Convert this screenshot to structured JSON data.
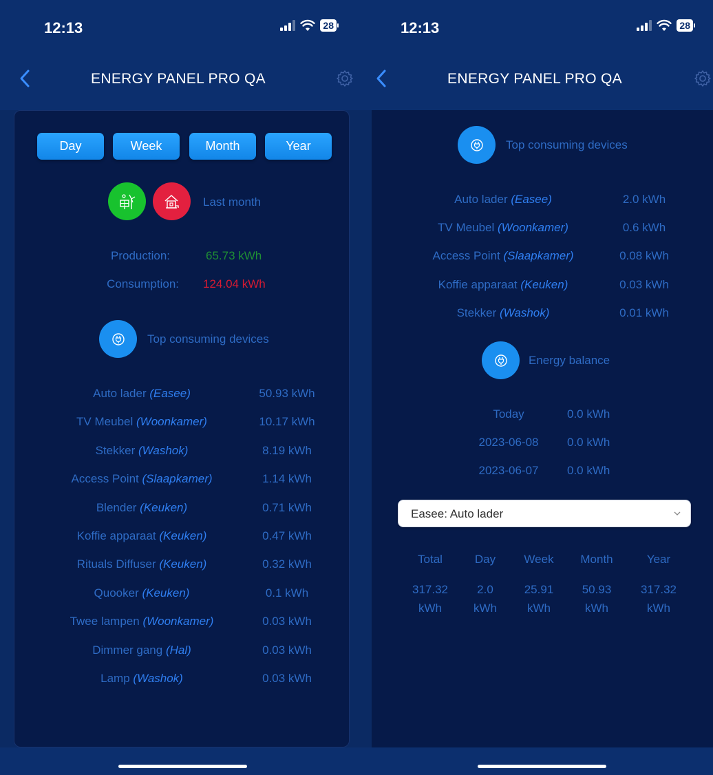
{
  "status": {
    "time": "12:13",
    "battery": "28"
  },
  "nav": {
    "title": "ENERGY PANEL PRO QA"
  },
  "periods": [
    "Day",
    "Week",
    "Month",
    "Year"
  ],
  "summary": {
    "label": "Last month",
    "production_label": "Production:",
    "production_value": "65.73 kWh",
    "consumption_label": "Consumption:",
    "consumption_value": "124.04 kWh"
  },
  "top_devices_title": "Top consuming devices",
  "left_devices": [
    {
      "name": "Auto lader",
      "loc": "(Easee)",
      "value": "50.93 kWh"
    },
    {
      "name": "TV Meubel",
      "loc": "(Woonkamer)",
      "value": "10.17 kWh"
    },
    {
      "name": "Stekker",
      "loc": "(Washok)",
      "value": "8.19 kWh"
    },
    {
      "name": "Access Point",
      "loc": "(Slaapkamer)",
      "value": "1.14 kWh"
    },
    {
      "name": "Blender",
      "loc": "(Keuken)",
      "value": "0.71 kWh"
    },
    {
      "name": "Koffie apparaat",
      "loc": "(Keuken)",
      "value": "0.47 kWh"
    },
    {
      "name": "Rituals Diffuser",
      "loc": "(Keuken)",
      "value": "0.32 kWh"
    },
    {
      "name": "Quooker",
      "loc": "(Keuken)",
      "value": "0.1 kWh"
    },
    {
      "name": "Twee lampen",
      "loc": "(Woonkamer)",
      "value": "0.03 kWh"
    },
    {
      "name": "Dimmer gang",
      "loc": "(Hal)",
      "value": "0.03 kWh"
    },
    {
      "name": "Lamp",
      "loc": "(Washok)",
      "value": "0.03 kWh"
    }
  ],
  "right_devices": [
    {
      "name": "Auto lader",
      "loc": "(Easee)",
      "value": "2.0 kWh"
    },
    {
      "name": "TV Meubel",
      "loc": "(Woonkamer)",
      "value": "0.6 kWh"
    },
    {
      "name": "Access Point",
      "loc": "(Slaapkamer)",
      "value": "0.08 kWh"
    },
    {
      "name": "Koffie apparaat",
      "loc": "(Keuken)",
      "value": "0.03 kWh"
    },
    {
      "name": "Stekker",
      "loc": "(Washok)",
      "value": "0.01 kWh"
    }
  ],
  "energy_balance": {
    "title": "Energy balance",
    "rows": [
      {
        "label": "Today",
        "value": "0.0 kWh"
      },
      {
        "label": "2023-06-08",
        "value": "0.0 kWh"
      },
      {
        "label": "2023-06-07",
        "value": "0.0 kWh"
      }
    ]
  },
  "device_select": {
    "value": "Easee: Auto lader"
  },
  "device_stats": [
    {
      "label": "Total",
      "value": "317.32",
      "unit": "kWh"
    },
    {
      "label": "Day",
      "value": "2.0",
      "unit": "kWh"
    },
    {
      "label": "Week",
      "value": "25.91",
      "unit": "kWh"
    },
    {
      "label": "Month",
      "value": "50.93",
      "unit": "kWh"
    },
    {
      "label": "Year",
      "value": "317.32",
      "unit": "kWh"
    }
  ],
  "colors": {
    "accent": "#1a8ff0",
    "production": "#1f8f34",
    "consumption": "#d71a32",
    "solar_badge": "#18c22e",
    "home_badge": "#e3203f",
    "card_bg": "#061a49",
    "nav_bg": "#0c2f6e"
  },
  "icons": {
    "back": "chevron-left-icon",
    "settings": "gear-icon",
    "solar": "solar-wind-icon",
    "home": "home-plug-icon",
    "plug": "plug-icon",
    "dropdown": "chevron-down-icon"
  }
}
